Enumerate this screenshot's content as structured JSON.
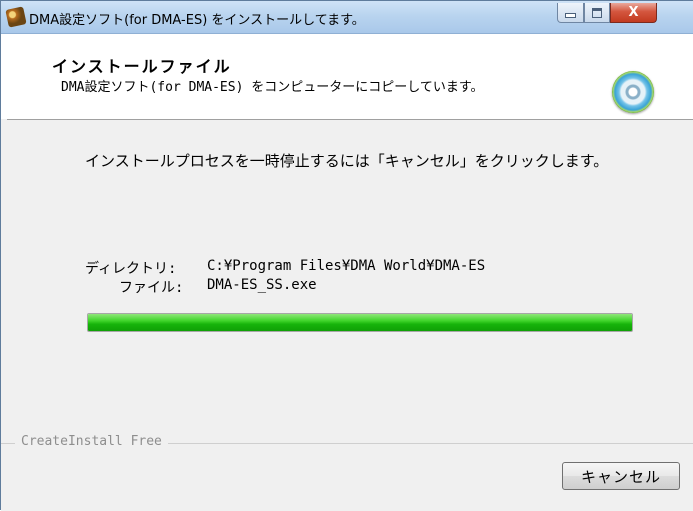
{
  "window": {
    "title": "DMA設定ソフト(for DMA-ES) をインストールしてます。",
    "controls": {
      "minimize_icon": "minimize-icon",
      "maximize_icon": "maximize-icon",
      "close_icon": "close-icon",
      "close_glyph": "X"
    }
  },
  "header": {
    "title": "インストールファイル",
    "description": "DMA設定ソフト(for DMA-ES) をコンピューターにコピーしています。",
    "icon": "cd-install-icon"
  },
  "body": {
    "instruction": "インストールプロセスを一時停止するには「キャンセル」をクリックします。",
    "directory_label": "ディレクトリ:",
    "directory_value": "C:¥Program Files¥DMA World¥DMA-ES",
    "file_label": "ファイル:",
    "file_value": "DMA-ES_SS.exe",
    "progress": 1.0
  },
  "footer": {
    "brand": "CreateInstall Free",
    "cancel_label": "キャンセル"
  },
  "colors": {
    "progress_green": "#17b40b",
    "titlebar_blue": "#b9d4ef",
    "close_red": "#c23a20"
  }
}
